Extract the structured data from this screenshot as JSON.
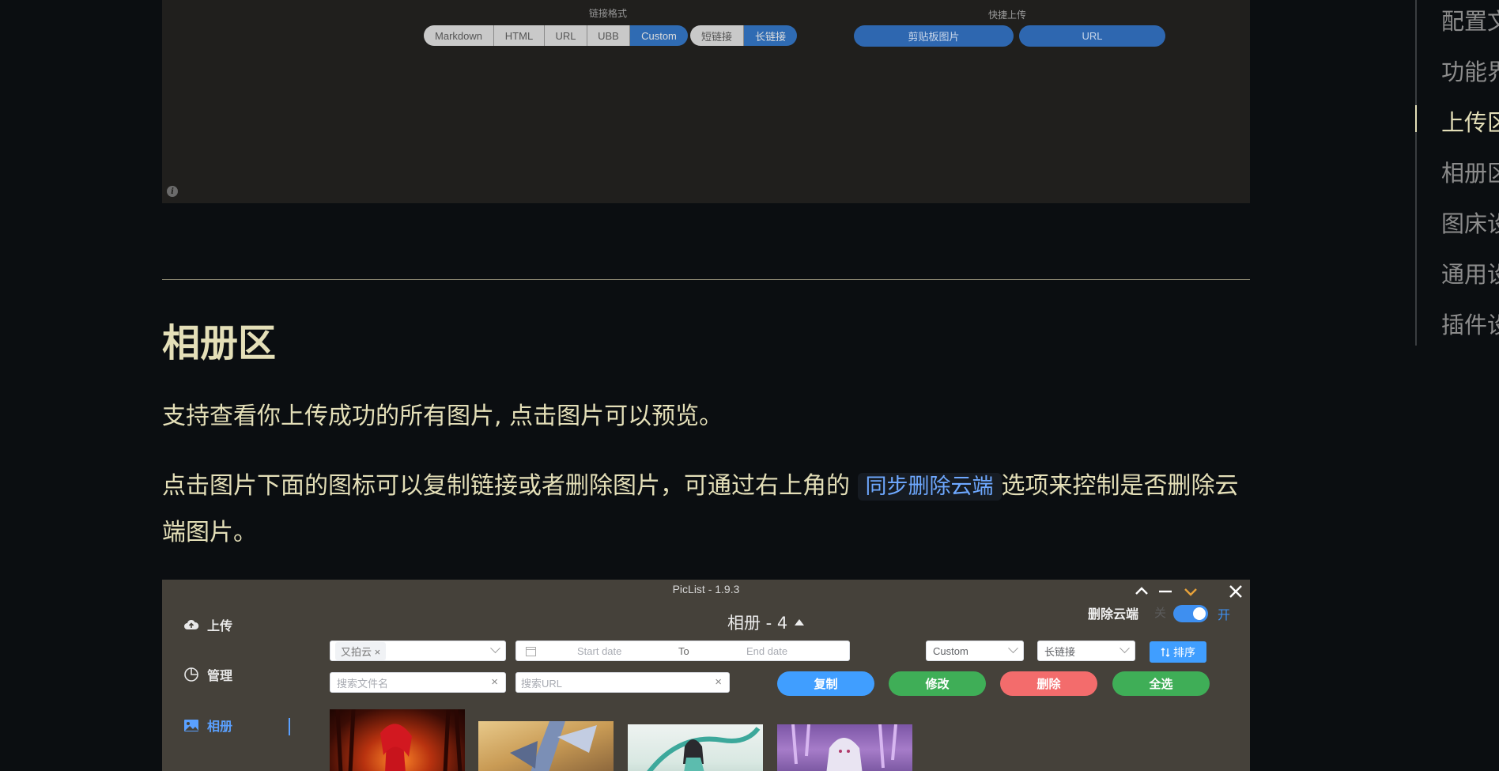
{
  "upload_screenshot": {
    "link_format_caption": "链接格式",
    "link_formats": [
      "Markdown",
      "HTML",
      "URL",
      "UBB",
      "Custom"
    ],
    "link_formats_selected": "Custom",
    "link_lengths": [
      "短链接",
      "长链接"
    ],
    "link_length_selected": "长链接",
    "quick_upload_caption": "快捷上传",
    "quick_upload_buttons": [
      "剪贴板图片",
      "URL"
    ]
  },
  "section": {
    "heading": "相册区",
    "para1": "支持查看你上传成功的所有图片, 点击图片可以预览。",
    "para2_before": "点击图片下面的图标可以复制链接或者删除图片，可通过右上角的",
    "para2_code": "同步删除云端",
    "para2_after": "选项来控制是否删除云端图片。"
  },
  "toc": {
    "items": [
      "配置文",
      "功能界",
      "上传区",
      "相册区",
      "图床设",
      "通用设",
      "插件设"
    ],
    "active_index": 2
  },
  "album_screenshot": {
    "window_title": "PicList - 1.9.3",
    "nav": [
      {
        "label": "上传",
        "icon": "cloud-upload-icon"
      },
      {
        "label": "管理",
        "icon": "pie-chart-icon"
      },
      {
        "label": "相册",
        "icon": "image-icon",
        "active": true
      }
    ],
    "album_title": "相册 - 4",
    "delete_cloud_label": "删除云端",
    "toggle_off_label": "关",
    "toggle_on_label": "开",
    "toggle_on": true,
    "bed_filter_tag": "又拍云",
    "start_date_placeholder": "Start date",
    "date_to": "To",
    "end_date_placeholder": "End date",
    "format_select": "Custom",
    "length_select": "长链接",
    "sort_label": "排序",
    "search_name_placeholder": "搜索文件名",
    "search_url_placeholder": "搜索URL",
    "actions": [
      {
        "label": "复制",
        "color": "#409eff"
      },
      {
        "label": "修改",
        "color": "#3fae57"
      },
      {
        "label": "删除",
        "color": "#f36c6c"
      },
      {
        "label": "全选",
        "color": "#3fae57"
      }
    ]
  },
  "colors": {
    "page_bg": "#0b0e11",
    "text": "#e4dfb8",
    "accent_blue": "#409eff",
    "minimize_orange": "#e8a23a"
  }
}
